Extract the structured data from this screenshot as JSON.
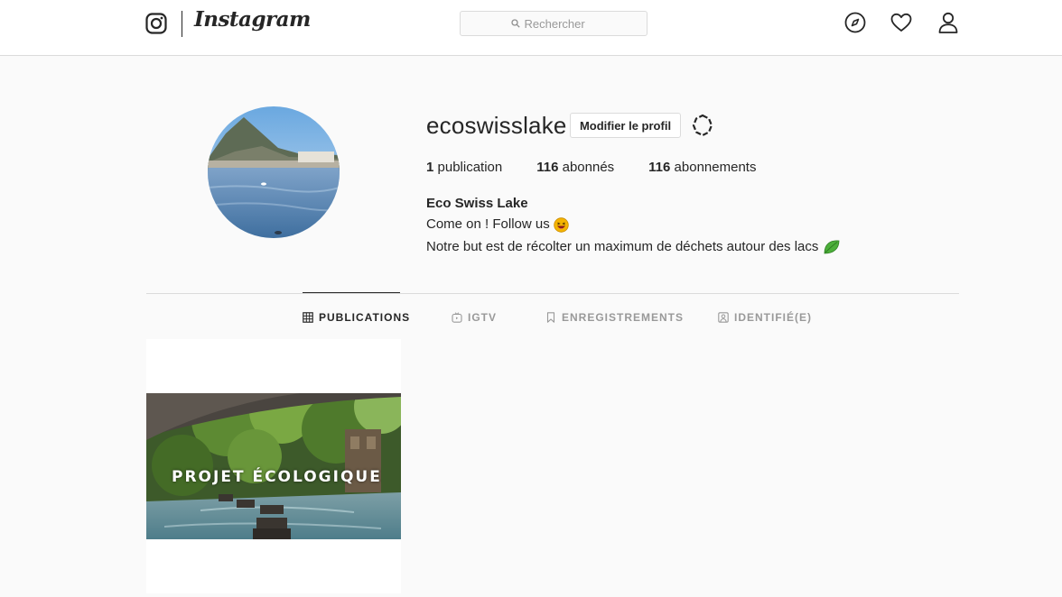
{
  "header": {
    "wordmark": "Instagram",
    "search": {
      "placeholder": "Rechercher"
    },
    "icons": [
      "explore-icon",
      "heart-icon",
      "profile-icon"
    ]
  },
  "profile": {
    "username": "ecoswisslake",
    "edit_button": "Modifier le profil",
    "stats": {
      "posts_count": "1",
      "posts_label": "publication",
      "followers_count": "116",
      "followers_label": "abonnés",
      "following_count": "116",
      "following_label": "abonnements"
    },
    "bio": {
      "name": "Eco Swiss Lake",
      "line1": "Come on ! Follow us",
      "line2": "Notre but est de récolter un maximum de déchets autour des lacs"
    }
  },
  "tabs": [
    {
      "label": "PUBLICATIONS",
      "icon": "grid-icon",
      "active": true
    },
    {
      "label": "IGTV",
      "icon": "tv-icon",
      "active": false
    },
    {
      "label": "ENREGISTREMENTS",
      "icon": "bookmark-icon",
      "active": false
    },
    {
      "label": "IDENTIFIÉ(E)",
      "icon": "tag-icon",
      "active": false
    }
  ],
  "posts": [
    {
      "caption": "PROJET ÉCOLOGIQUE"
    }
  ],
  "colors": {
    "background": "#fafafa",
    "border": "#dbdbdb",
    "text": "#262626",
    "muted": "#999999"
  }
}
